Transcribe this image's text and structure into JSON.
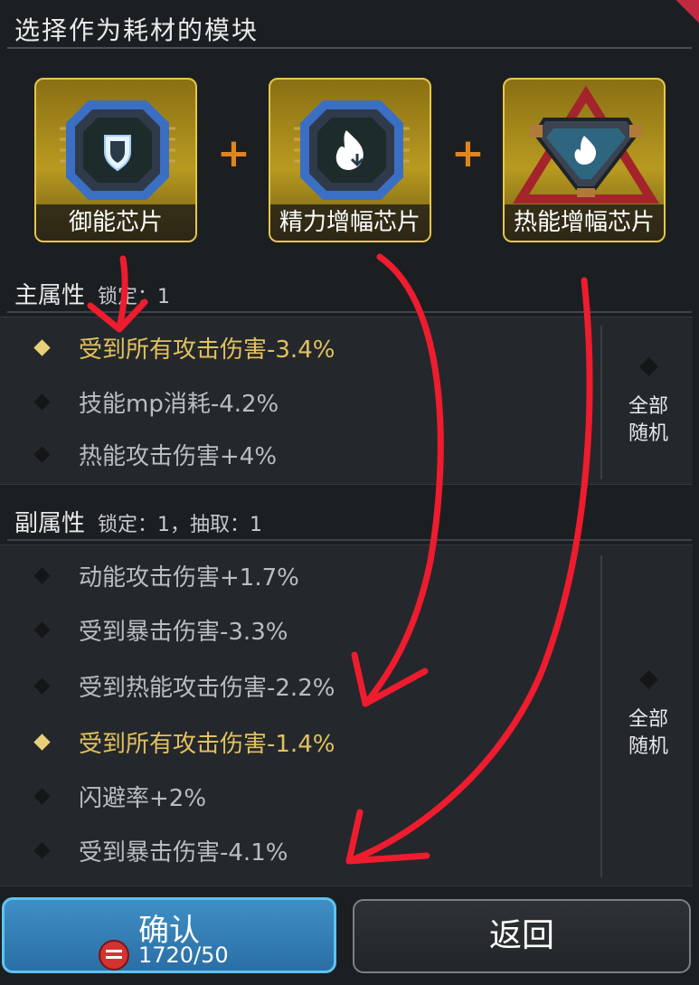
{
  "header": {
    "title": "选择作为耗材的模块"
  },
  "chips": [
    {
      "name": "御能芯片",
      "icon": "shield-chip-icon"
    },
    {
      "name": "精力增幅芯片",
      "icon": "flame-chip-icon"
    },
    {
      "name": "热能增幅芯片",
      "icon": "heat-triangle-chip-icon"
    }
  ],
  "plus_symbol": "+",
  "main_attributes": {
    "heading": "主属性",
    "lock_info": "锁定：1",
    "rows": [
      {
        "text": "受到所有攻击伤害-3.4%",
        "locked": true
      },
      {
        "text": "技能mp消耗-4.2%",
        "locked": false
      },
      {
        "text": "热能攻击伤害+4%",
        "locked": false
      }
    ],
    "random_label": "全部随机"
  },
  "sub_attributes": {
    "heading": "副属性",
    "lock_info": "锁定：1，抽取：1",
    "rows": [
      {
        "text": "动能攻击伤害+1.7%",
        "locked": false
      },
      {
        "text": "受到暴击伤害-3.3%",
        "locked": false
      },
      {
        "text": "受到热能攻击伤害-2.2%",
        "locked": false
      },
      {
        "text": "受到所有攻击伤害-1.4%",
        "locked": true
      },
      {
        "text": "闪避率+2%",
        "locked": false
      },
      {
        "text": "受到暴击伤害-4.1%",
        "locked": false
      }
    ],
    "random_label": "全部随机"
  },
  "buttons": {
    "confirm": {
      "label": "确认",
      "cost": "1720/50",
      "cost_icon": "currency-icon"
    },
    "back": {
      "label": "返回"
    }
  },
  "colors": {
    "accent_gold": "#e2c15e",
    "confirm_blue": "#3f8fc6",
    "annotation_red": "#ee1c2e"
  }
}
